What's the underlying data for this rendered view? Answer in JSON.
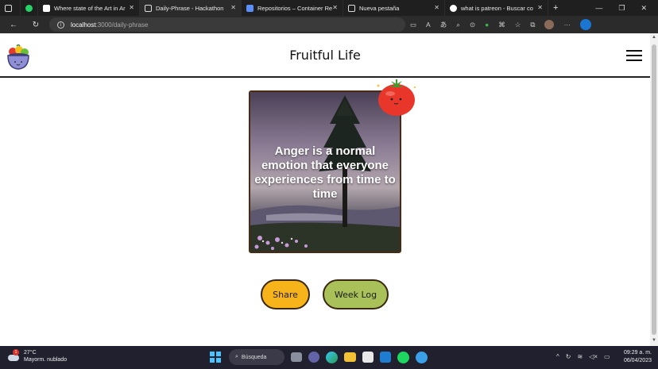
{
  "browser": {
    "tabs": [
      {
        "label": "",
        "icon": "tab-actions-icon"
      },
      {
        "label": "",
        "icon": "whatsapp-icon"
      },
      {
        "label": "Where state of the Art in Ar",
        "icon": "notion-icon"
      },
      {
        "label": "Daily-Phrase - Hackathon",
        "icon": "page-icon",
        "active": true
      },
      {
        "label": "Repositorios – Container Re",
        "icon": "azure-icon"
      },
      {
        "label": "Nueva pestaña",
        "icon": "newtab-icon"
      },
      {
        "label": "what is patreon - Buscar co",
        "icon": "google-icon"
      }
    ],
    "new_tab": "+",
    "url_host": "localhost",
    "url_path": ":3000/daily-phrase"
  },
  "page": {
    "title": "Fruitful Life",
    "quote": "Anger is a normal emotion that everyone experiences from time to time",
    "share_label": "Share",
    "weeklog_label": "Week Log"
  },
  "taskbar": {
    "temperature": "27°C",
    "weather_desc": "Mayorm. nublado",
    "weather_badge": "1",
    "search_label": "Búsqueda",
    "time": "09:29 a. m.",
    "date": "06/04/2023"
  },
  "colors": {
    "share": "#f6b31a",
    "weeklog": "#a9c159",
    "tab_bar": "#1f1f1f"
  }
}
